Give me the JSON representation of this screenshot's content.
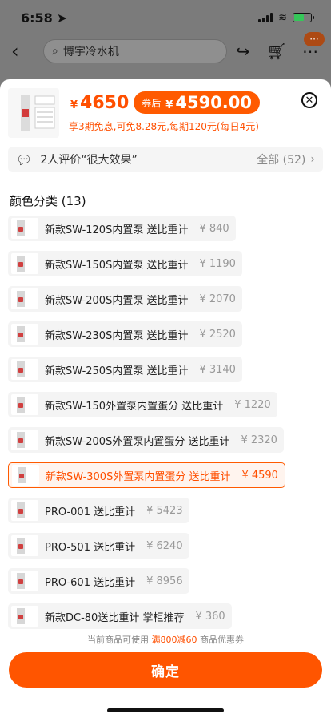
{
  "status_bar": {
    "time": "6:58"
  },
  "header": {
    "search_placeholder": "博宇冷水机",
    "more_badge": "···"
  },
  "product": {
    "price": "4650",
    "price_currency": "¥",
    "coupon_label": "券后",
    "coupon_price": "4590.00",
    "installment_text": "享3期免息,可免8.28元,每期120元(每日4元)"
  },
  "review": {
    "text": "2人评价“很大效果”",
    "all_label": "全部 (52)"
  },
  "options_title": "颜色分类 (13)",
  "options": [
    {
      "label": "新款SW-120S内置泵 送比重计",
      "price": "¥ 840",
      "selected": false
    },
    {
      "label": "新款SW-150S内置泵 送比重计",
      "price": "¥ 1190",
      "selected": false
    },
    {
      "label": "新款SW-200S内置泵 送比重计",
      "price": "¥ 2070",
      "selected": false
    },
    {
      "label": "新款SW-230S内置泵 送比重计",
      "price": "¥ 2520",
      "selected": false
    },
    {
      "label": "新款SW-250S内置泵 送比重计",
      "price": "¥ 3140",
      "selected": false
    },
    {
      "label": "新款SW-150外置泵内置蛋分 送比重计",
      "price": "¥ 1220",
      "selected": false
    },
    {
      "label": "新款SW-200S外置泵内置蛋分 送比重计",
      "price": "¥ 2320",
      "selected": false
    },
    {
      "label": "新款SW-300S外置泵内置蛋分 送比重计",
      "price": "¥ 4590",
      "selected": true
    },
    {
      "label": "PRO-001 送比重计",
      "price": "¥ 5423",
      "selected": false
    },
    {
      "label": "PRO-501 送比重计",
      "price": "¥ 6240",
      "selected": false
    },
    {
      "label": "PRO-601 送比重计",
      "price": "¥ 8956",
      "selected": false
    },
    {
      "label": "新款DC-80送比重计 掌柜推荐",
      "price": "¥ 360",
      "selected": false
    }
  ],
  "promo": {
    "prefix": "当前商品可使用",
    "highlight": "满800减60",
    "suffix": "商品优惠券"
  },
  "confirm_label": "确定",
  "colors": {
    "accent": "#ff5500",
    "price": "#ff4f00"
  }
}
